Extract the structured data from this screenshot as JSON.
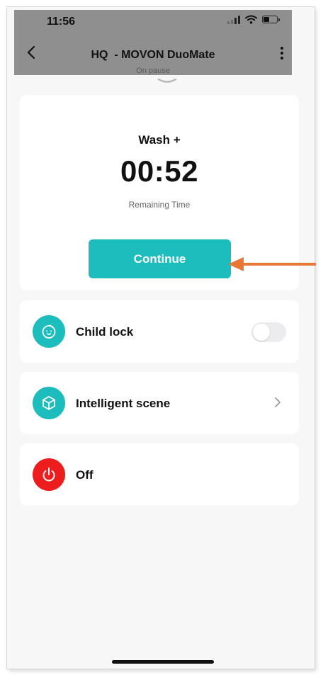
{
  "status_bar": {
    "time": "11:56",
    "battery_fraction": 0.45
  },
  "nav": {
    "back_icon": "chevron-left-icon",
    "title": "HQ  - MOVON DuoMate",
    "subtitle": "On pause",
    "more_icon": "more-vertical-icon"
  },
  "program": {
    "name": "Wash +",
    "remaining_time": "00:52",
    "remaining_label": "Remaining Time",
    "continue_label": "Continue"
  },
  "rows": {
    "child_lock": {
      "label": "Child lock",
      "icon": "baby-face-icon",
      "enabled": false
    },
    "intelligent_scene": {
      "label": "Intelligent scene",
      "icon": "cube-icon"
    },
    "off": {
      "label": "Off",
      "icon": "power-icon"
    }
  },
  "colors": {
    "accent": "#1dbcbd",
    "power": "#ee1d1d",
    "annotation_arrow": "#e87634",
    "header_overlay": "#8f8f90"
  }
}
